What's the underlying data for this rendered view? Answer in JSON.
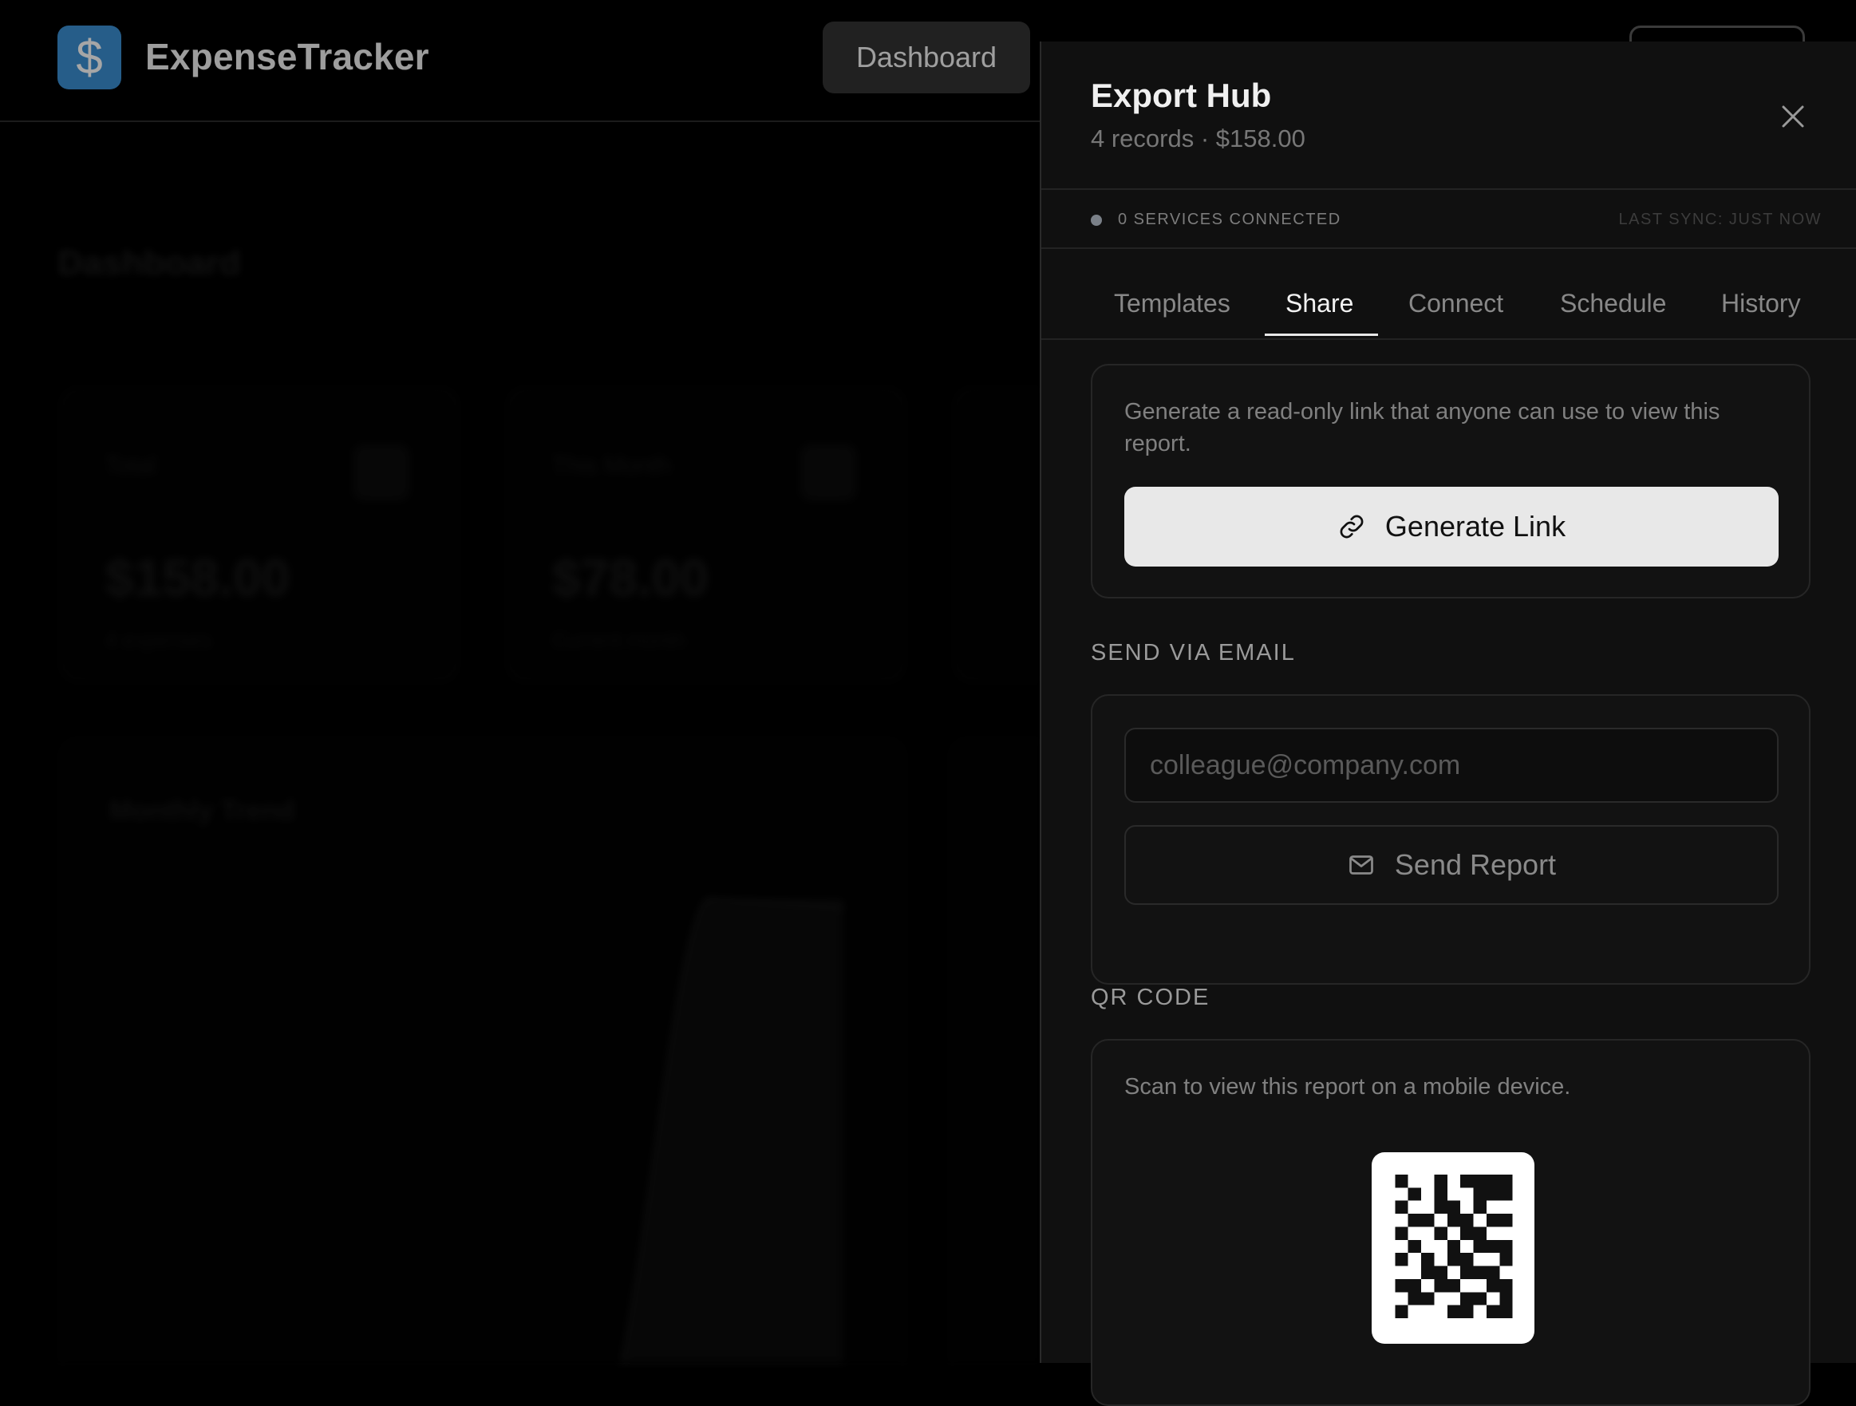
{
  "header": {
    "app_title": "ExpenseTracker",
    "logo_glyph": "$",
    "nav_dashboard": "Dashboard"
  },
  "background": {
    "page_title": "Dashboard",
    "stat_cards": [
      {
        "label": "Total",
        "value": "$158.00",
        "foot": "4 expenses"
      },
      {
        "label": "This Month",
        "value": "$78.00",
        "foot": "Current month"
      },
      {
        "label": "",
        "value": "",
        "foot": ""
      }
    ],
    "chart_title": "Monthly Trend"
  },
  "export_hub": {
    "title": "Export Hub",
    "subtitle": "4 records · $158.00",
    "status_text": "0 SERVICES CONNECTED",
    "last_sync": "LAST SYNC: JUST NOW",
    "tabs": [
      {
        "label": "Templates",
        "active": false
      },
      {
        "label": "Share",
        "active": true
      },
      {
        "label": "Connect",
        "active": false
      },
      {
        "label": "Schedule",
        "active": false
      },
      {
        "label": "History",
        "active": false
      }
    ],
    "share": {
      "description": "Generate a read-only link that anyone can use to view this report.",
      "generate_label": "Generate Link",
      "email_section_title": "SEND VIA EMAIL",
      "email_placeholder": "colleague@company.com",
      "email_value": "",
      "send_label": "Send Report",
      "qr_section_title": "QR CODE",
      "qr_description": "Scan to view this report on a mobile device."
    }
  },
  "icons": [
    "dollar-icon",
    "close-icon",
    "link-icon",
    "mail-icon",
    "qr-code"
  ],
  "colors": {
    "accent": "#3b8fd3",
    "panel_bg": "#101010",
    "primary_button": "#e8e8e8"
  }
}
